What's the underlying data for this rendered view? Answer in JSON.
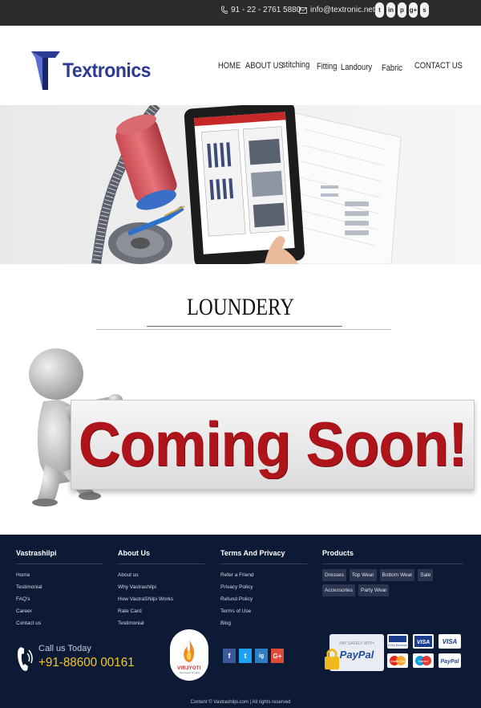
{
  "topbar": {
    "phone": "91 - 22 - 2761 5880",
    "email": "info@textronic.net",
    "social_icons": [
      "twitter-icon",
      "linkedin-icon",
      "pinterest-icon",
      "google-plus-icon",
      "skype-icon"
    ],
    "social_glyphs": [
      "t",
      "in",
      "p",
      "g+",
      "s"
    ]
  },
  "header": {
    "logo_text": "Textronics",
    "nav": [
      "HOME",
      "ABOUT US",
      "stitching",
      "Fitting",
      "Landoury",
      "Fabric",
      "CONTACT US"
    ]
  },
  "hero": {
    "image": "tailoring-tablet-banner"
  },
  "section": {
    "title": "LOUNDERY"
  },
  "coming_soon": {
    "text": "Coming Soon!"
  },
  "footer": {
    "col1": {
      "title": "Vastrashilpi",
      "links": [
        "Home",
        "Testimonial",
        "FAQ's",
        "Career",
        "Contact us"
      ]
    },
    "col2": {
      "title": "About Us",
      "links": [
        "About us",
        "Why Vastrashilpi",
        "How VastraShilpi Works",
        "Rate Card",
        "Testimonial"
      ]
    },
    "col3": {
      "title": "Terms And Privacy",
      "links": [
        "Refer a Friend",
        "Privacy Policy",
        "Refund Policy",
        "Terms of Use",
        "Blog"
      ]
    },
    "col4": {
      "title": "Products",
      "tags": [
        "Dresses",
        "Top Wear",
        "Bottom Wear",
        "Sale",
        "Accessories",
        "Party Wear"
      ]
    },
    "call_label": "Call us Today",
    "call_number": "+91-88600 00161",
    "brand_name": "VIRJYOTI",
    "brand_sub": "The Power of Light",
    "social": [
      "f",
      "t",
      "ig",
      "G+"
    ],
    "social_colors": [
      "#3b5998",
      "#1da1f2",
      "#2d7fc1",
      "#dd4b39"
    ],
    "payment": {
      "safely": "PAY SAFELY WITH",
      "paypal": "PayPal",
      "cards": [
        "VISA Electron",
        "VISA",
        "VISA",
        "MasterCard",
        "Maestro",
        "PayPal"
      ]
    },
    "copyright": "Content © Vastrashilpi.com | All rights reserved"
  }
}
